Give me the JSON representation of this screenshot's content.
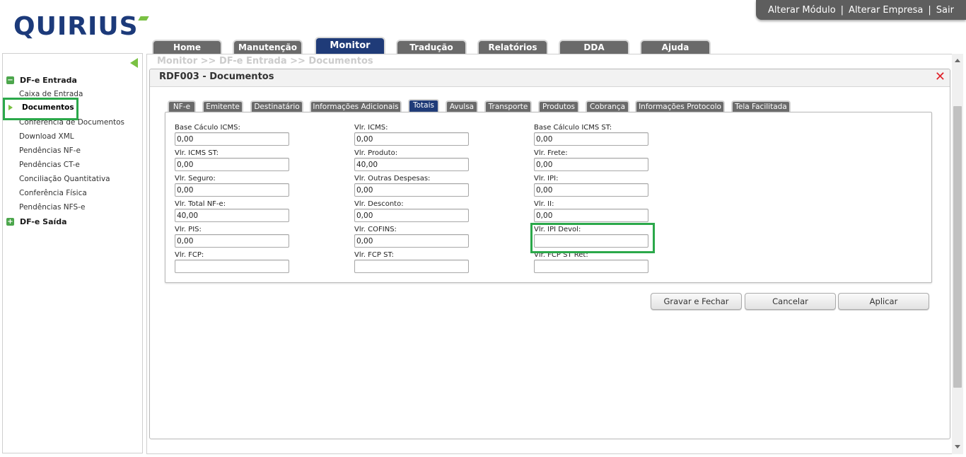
{
  "app": {
    "logo_text": "QUIRIUS",
    "brand_color": "#1c3a7a",
    "accent_color": "#7ac143"
  },
  "topmenu": {
    "alterar_modulo": "Alterar Módulo",
    "separator": "|",
    "alterar_empresa": "Alterar Empresa",
    "sair": "Sair"
  },
  "main_tabs": [
    {
      "label": "Home",
      "active": false
    },
    {
      "label": "Manutenção",
      "active": false
    },
    {
      "label": "Monitor",
      "active": true
    },
    {
      "label": "Tradução",
      "active": false
    },
    {
      "label": "Relatórios",
      "active": false
    },
    {
      "label": "DDA",
      "active": false
    },
    {
      "label": "Ajuda",
      "active": false
    }
  ],
  "sidebar": {
    "groups": [
      {
        "label": "DF-e Entrada",
        "toggle": "−",
        "expanded": true
      },
      {
        "label": "DF-e Saída",
        "toggle": "+",
        "expanded": false
      }
    ],
    "items": [
      {
        "label": "Caixa de Entrada"
      },
      {
        "label": "Documentos",
        "selected": true
      },
      {
        "label": "Conferência de Documentos"
      },
      {
        "label": "Download XML"
      },
      {
        "label": "Pendências NF-e"
      },
      {
        "label": "Pendências CT-e"
      },
      {
        "label": "Conciliação Quantitativa"
      },
      {
        "label": "Conferência Física"
      },
      {
        "label": "Pendências NFS-e"
      }
    ]
  },
  "breadcrumb": "Monitor >> DF-e Entrada >> Documentos",
  "panel": {
    "title": "RDF003 - Documentos",
    "close_symbol": "✕"
  },
  "sub_tabs": [
    {
      "label": "NF-e"
    },
    {
      "label": "Emitente"
    },
    {
      "label": "Destinatário"
    },
    {
      "label": "Informações Adicionais"
    },
    {
      "label": "Totais",
      "active": true
    },
    {
      "label": "Avulsa"
    },
    {
      "label": "Transporte"
    },
    {
      "label": "Produtos"
    },
    {
      "label": "Cobrança"
    },
    {
      "label": "Informações Protocolo"
    },
    {
      "label": "Tela Facilitada"
    }
  ],
  "fields": {
    "base_calculo_icms": {
      "label": "Base Cáculo ICMS:",
      "value": "0,00"
    },
    "vlr_icms": {
      "label": "Vlr. ICMS:",
      "value": "0,00"
    },
    "base_calculo_icms_st": {
      "label": "Base Cálculo ICMS ST:",
      "value": "0,00"
    },
    "vlr_icms_st": {
      "label": "Vlr. ICMS ST:",
      "value": "0,00"
    },
    "vlr_produto": {
      "label": "Vlr. Produto:",
      "value": "40,00"
    },
    "vlr_frete": {
      "label": "Vlr. Frete:",
      "value": "0,00"
    },
    "vlr_seguro": {
      "label": "Vlr. Seguro:",
      "value": "0,00"
    },
    "vlr_outras_despesas": {
      "label": "Vlr. Outras Despesas:",
      "value": "0,00"
    },
    "vlr_ipi": {
      "label": "Vlr. IPI:",
      "value": "0,00"
    },
    "vlr_total_nfe": {
      "label": "Vlr. Total NF-e:",
      "value": "40,00"
    },
    "vlr_desconto": {
      "label": "Vlr. Desconto:",
      "value": "0,00"
    },
    "vlr_ii": {
      "label": "Vlr. II:",
      "value": "0,00"
    },
    "vlr_pis": {
      "label": "Vlr. PIS:",
      "value": "0,00"
    },
    "vlr_cofins": {
      "label": "Vlr. COFINS:",
      "value": "0,00"
    },
    "vlr_ipi_devol": {
      "label": "Vlr. IPI Devol:",
      "value": ""
    },
    "vlr_fcp": {
      "label": "Vlr. FCP:",
      "value": ""
    },
    "vlr_fcp_st": {
      "label": "Vlr. FCP ST:",
      "value": ""
    },
    "vlr_fcp_st_ret": {
      "label": "Vlr. FCP ST Ret:",
      "value": ""
    }
  },
  "buttons": {
    "gravar_fechar": "Gravar e Fechar",
    "cancelar": "Cancelar",
    "aplicar": "Aplicar"
  }
}
